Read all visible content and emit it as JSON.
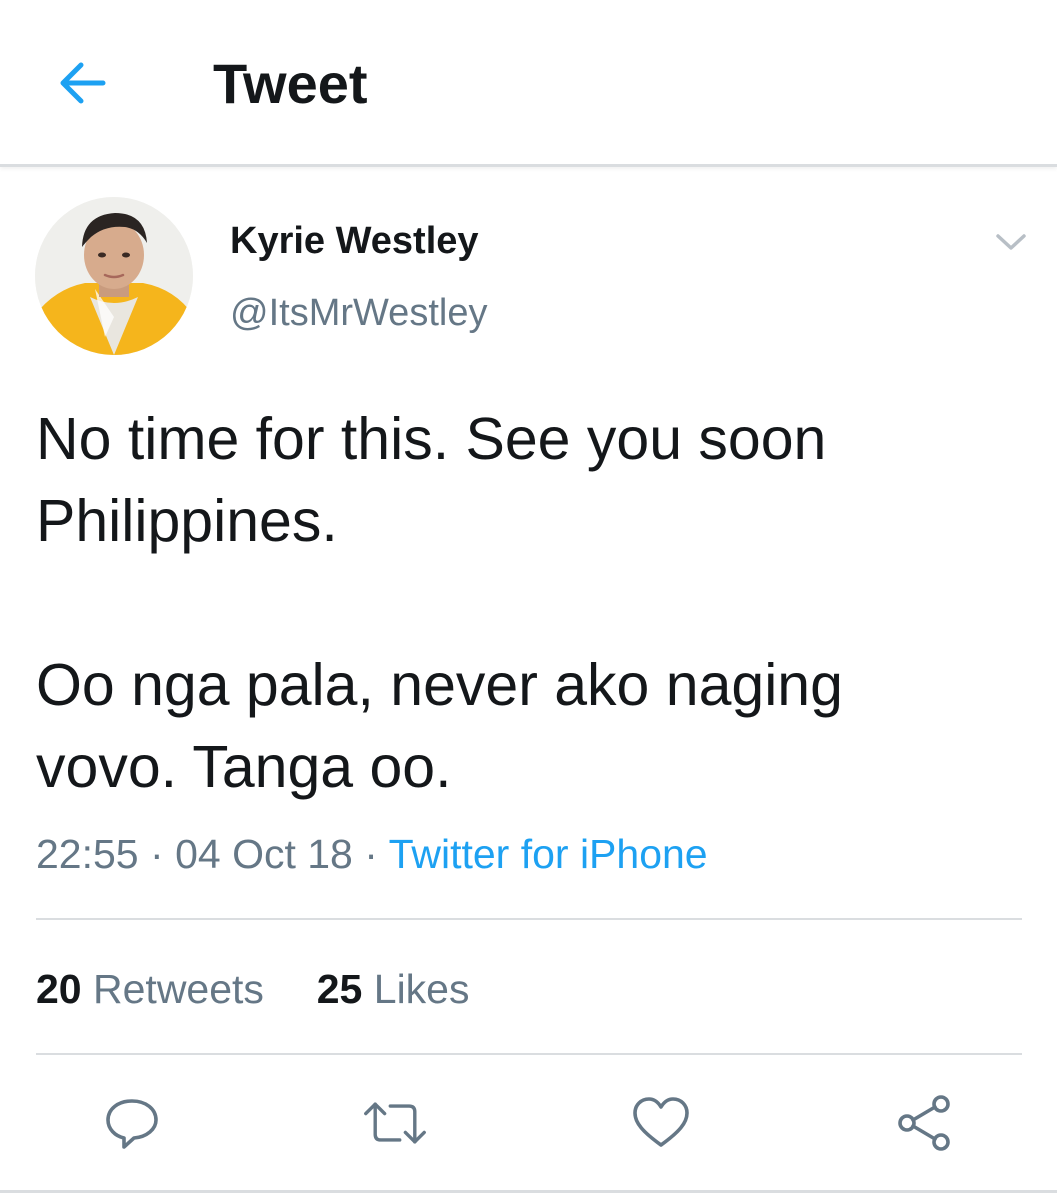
{
  "header": {
    "title": "Tweet",
    "back_icon": "arrow-left-icon",
    "accent_color": "#1da1f2"
  },
  "tweet": {
    "author": {
      "display_name": "Kyrie Westley",
      "handle": "@ItsMrWestley"
    },
    "text": "No time for this. See you soon\nPhilippines.\n\nOo nga pala, never ako naging\nvovo. Tanga oo.",
    "time": "22:55",
    "date": "04 Oct 18",
    "separator": "·",
    "source": "Twitter for iPhone",
    "retweet_count": "20",
    "retweet_label": "Retweets",
    "like_count": "25",
    "like_label": "Likes",
    "menu_icon": "chevron-down-icon"
  },
  "actions": [
    {
      "name": "reply",
      "icon": "reply-icon"
    },
    {
      "name": "retweet",
      "icon": "retweet-icon"
    },
    {
      "name": "like",
      "icon": "heart-icon"
    },
    {
      "name": "share",
      "icon": "share-icon"
    }
  ],
  "colors": {
    "text_primary": "#14171a",
    "text_secondary": "#657786",
    "link": "#1da1f2",
    "divider": "#dadde0"
  }
}
